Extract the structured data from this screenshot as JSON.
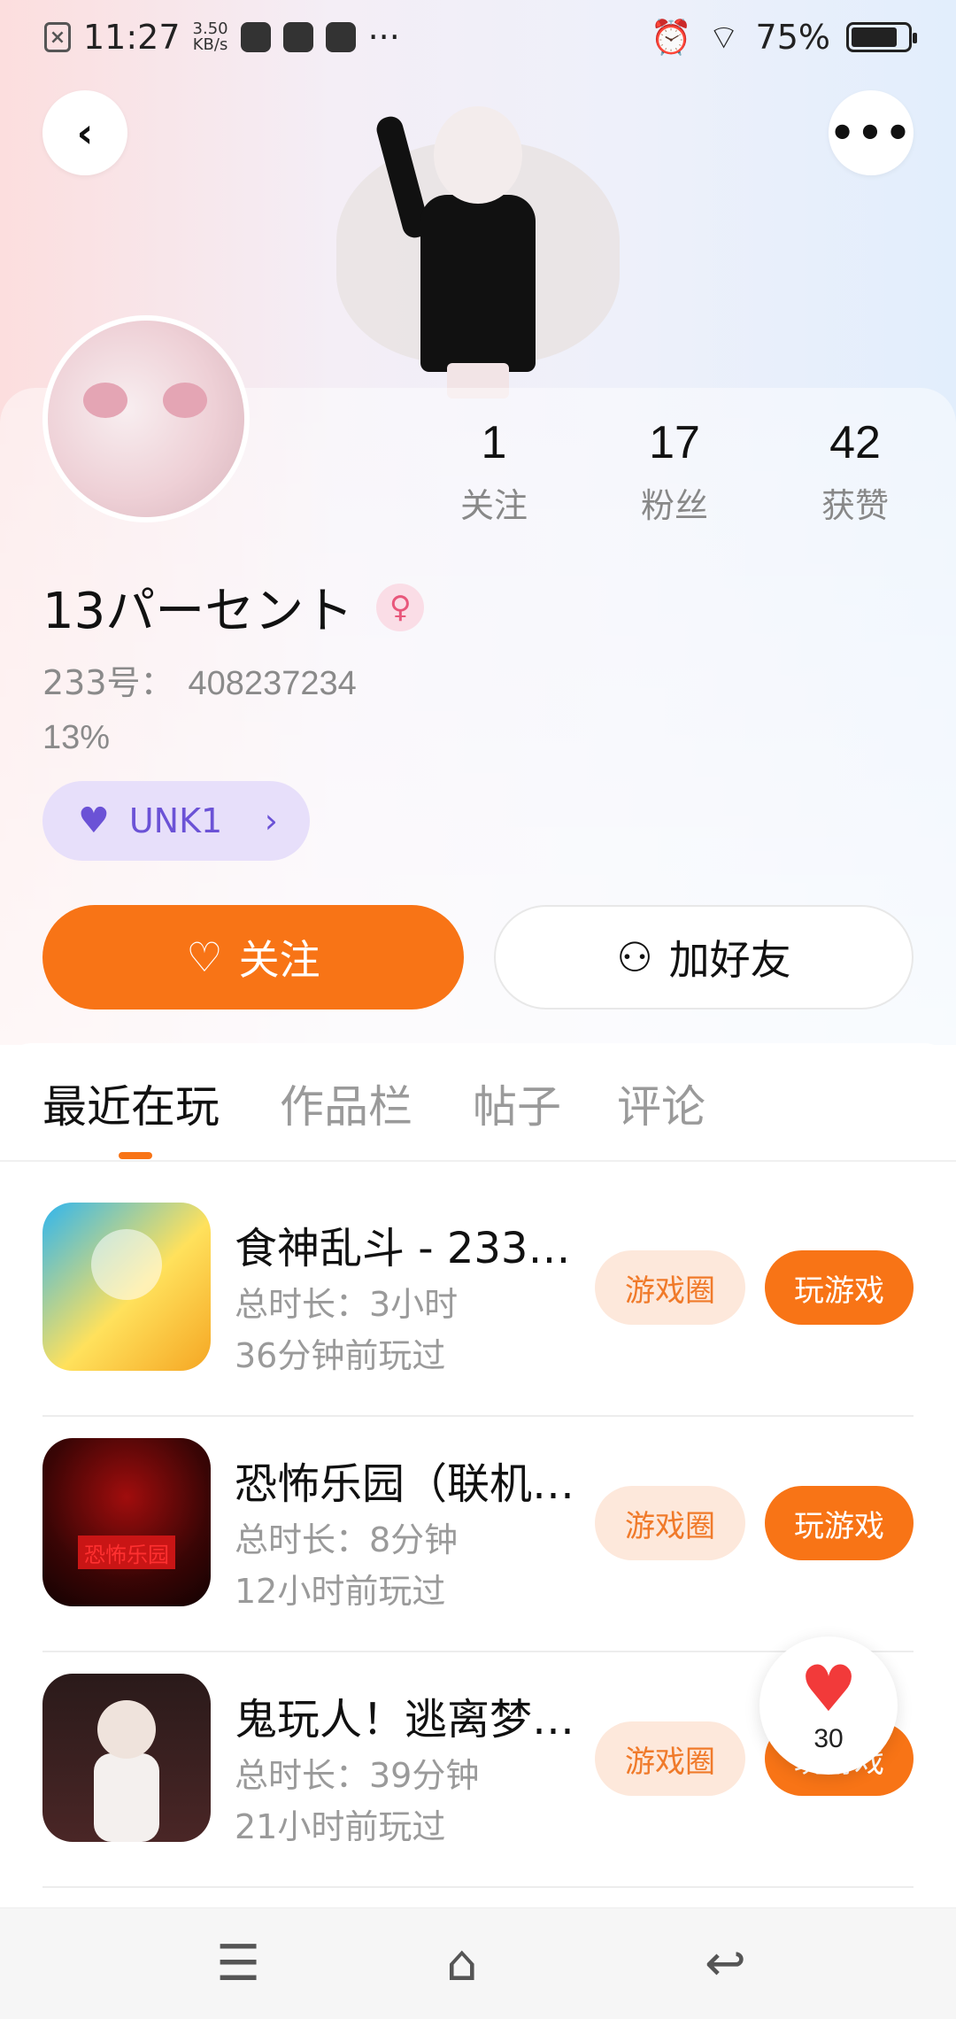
{
  "status_bar": {
    "time": "11:27",
    "speed_value": "3.50",
    "speed_unit": "KB/s",
    "battery": "75%",
    "more": "···"
  },
  "profile": {
    "name": "13パーセント",
    "gender_symbol": "♀",
    "uid_label": "233号：",
    "uid_value": "408237234",
    "bio": "13%",
    "badge_label": "UNK1"
  },
  "stats": [
    {
      "value": "1",
      "label": "关注"
    },
    {
      "value": "17",
      "label": "粉丝"
    },
    {
      "value": "42",
      "label": "获赞"
    }
  ],
  "actions": {
    "follow_label": "关注",
    "add_friend_label": "加好友"
  },
  "tabs": [
    "最近在玩",
    "作品栏",
    "帖子",
    "评论"
  ],
  "games": [
    {
      "title": "食神乱斗 - 233…",
      "duration": "总时长：3小时",
      "last_played": "36分钟前玩过",
      "circle_label": "游戏圈",
      "play_label": "玩游戏"
    },
    {
      "title": "恐怖乐园（联机…",
      "duration": "总时长：8分钟",
      "last_played": "12小时前玩过",
      "circle_label": "游戏圈",
      "play_label": "玩游戏",
      "icon_text": "恐怖乐园"
    },
    {
      "title": "鬼玩人！逃离梦…",
      "duration": "总时长：39分钟",
      "last_played": "21小时前玩过",
      "circle_label": "游戏圈",
      "play_label": "玩游戏"
    }
  ],
  "like": {
    "count": "30"
  },
  "icons": {
    "back": "‹",
    "more": "•••",
    "heart": "♥",
    "badge_arrow": "›",
    "follow": "♡",
    "add_friend": "⚇",
    "nav_menu": "☰",
    "nav_home": "⌂",
    "nav_back": "↩"
  },
  "colors": {
    "accent": "#f87416",
    "badge_bg": "#e7dffa",
    "badge_fg": "#6b52d6",
    "like_heart": "#f23a3a"
  }
}
